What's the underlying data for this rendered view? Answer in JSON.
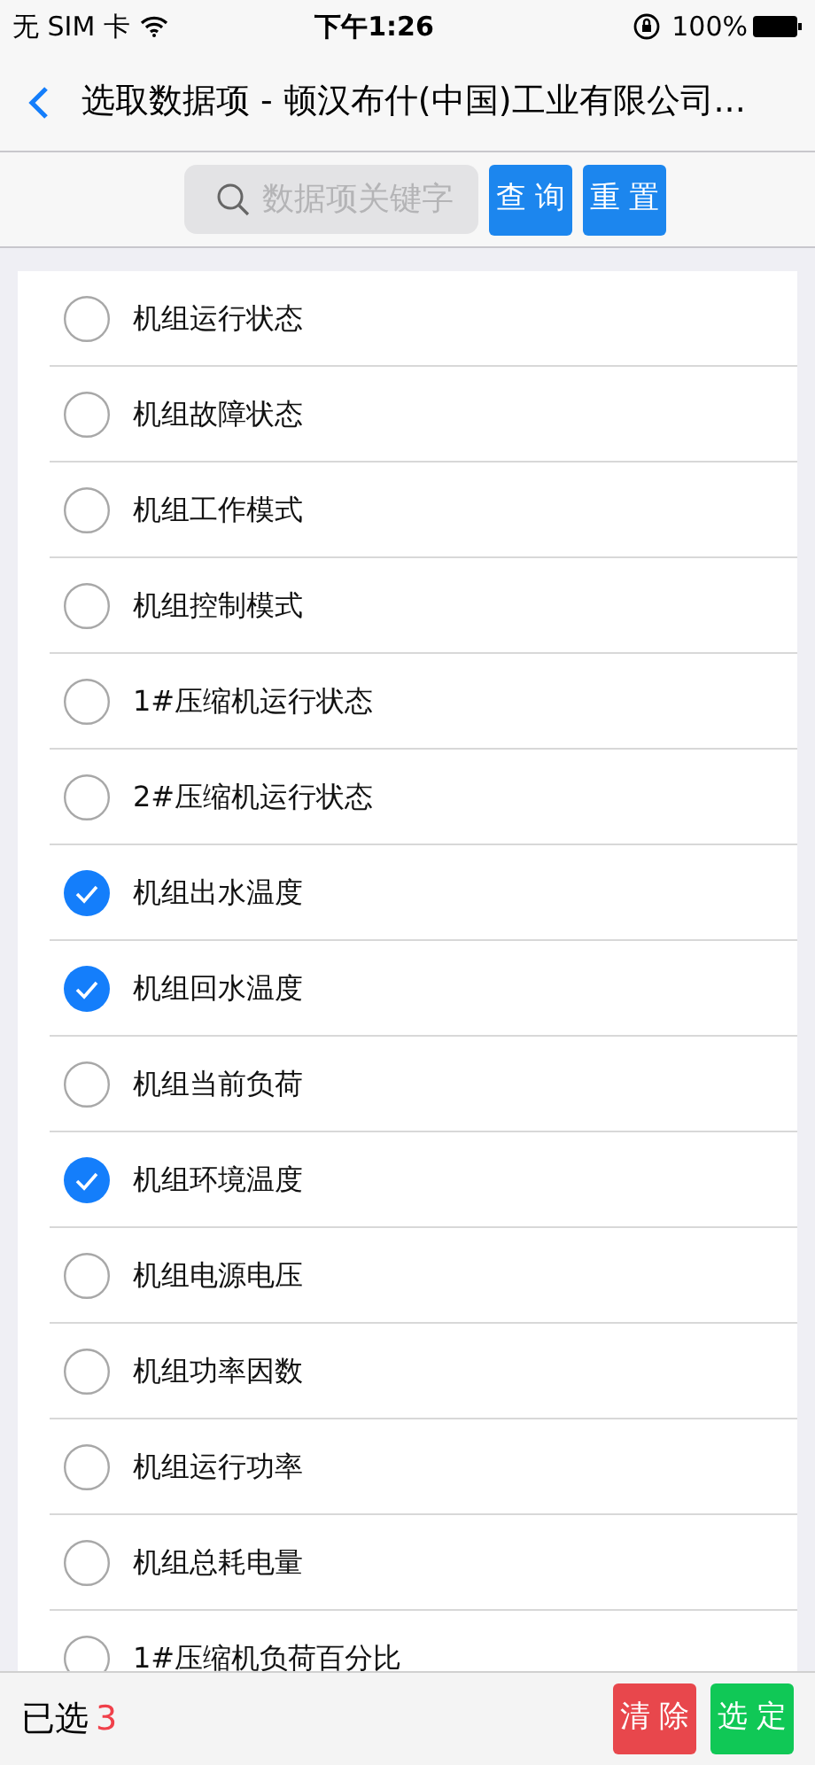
{
  "status_bar": {
    "carrier": "无 SIM 卡",
    "time": "下午1:26",
    "battery": "100%"
  },
  "nav": {
    "title": "选取数据项 - 顿汉布什(中国)工业有限公司..."
  },
  "search": {
    "placeholder": "数据项关键字",
    "buttons": [
      "查 询",
      "重 置"
    ]
  },
  "items": [
    {
      "label": "机组运行状态",
      "checked": false
    },
    {
      "label": "机组故障状态",
      "checked": false
    },
    {
      "label": "机组工作模式",
      "checked": false
    },
    {
      "label": "机组控制模式",
      "checked": false
    },
    {
      "label": "1#压缩机运行状态",
      "checked": false
    },
    {
      "label": "2#压缩机运行状态",
      "checked": false
    },
    {
      "label": "机组出水温度",
      "checked": true
    },
    {
      "label": "机组回水温度",
      "checked": true
    },
    {
      "label": "机组当前负荷",
      "checked": false
    },
    {
      "label": "机组环境温度",
      "checked": true
    },
    {
      "label": "机组电源电压",
      "checked": false
    },
    {
      "label": "机组功率因数",
      "checked": false
    },
    {
      "label": "机组运行功率",
      "checked": false
    },
    {
      "label": "机组总耗电量",
      "checked": false
    },
    {
      "label": "1#压缩机负荷百分比",
      "checked": false
    }
  ],
  "footer": {
    "label": "已选",
    "count": "3",
    "clear_button": "清 除",
    "confirm_button": "选 定"
  }
}
